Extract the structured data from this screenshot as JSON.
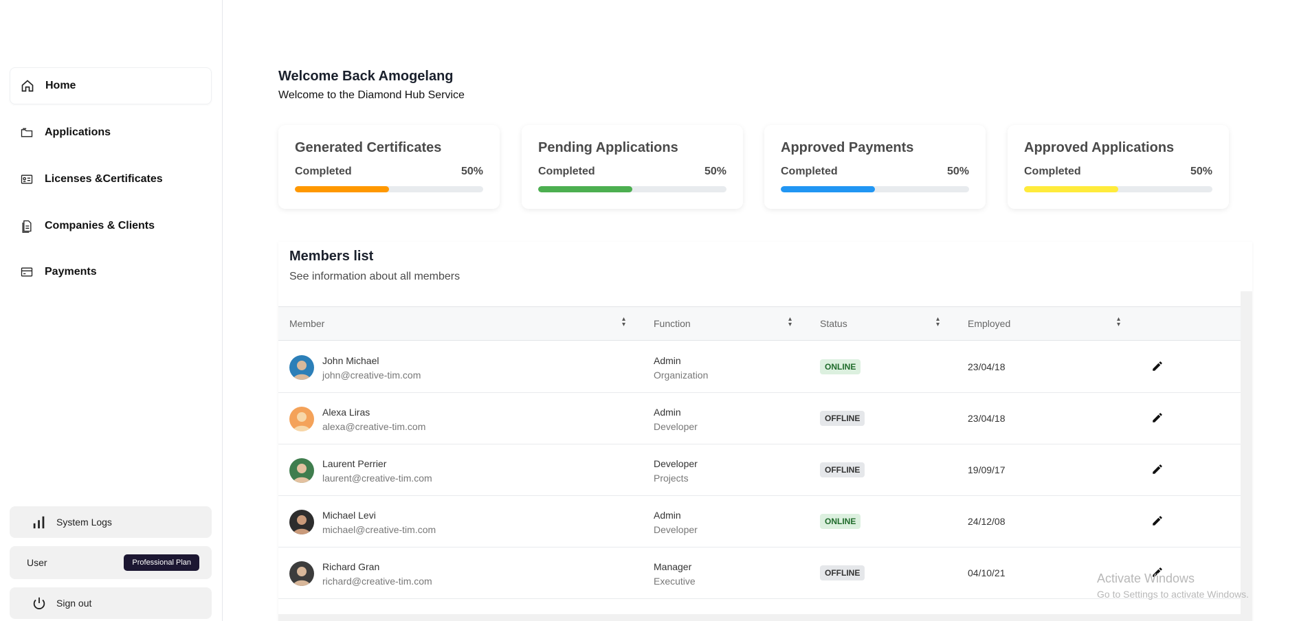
{
  "sidebar": {
    "items": [
      {
        "label": "Home",
        "icon": "home-icon"
      },
      {
        "label": "Applications",
        "icon": "folder-icon"
      },
      {
        "label": "Licenses &Certificates",
        "icon": "id-card-icon"
      },
      {
        "label": "Companies & Clients",
        "icon": "document-icon"
      },
      {
        "label": "Payments",
        "icon": "card-icon"
      }
    ],
    "system_logs": "System Logs",
    "user_label": "User",
    "plan_badge": "Professional Plan",
    "sign_out": "Sign out"
  },
  "welcome": {
    "title": "Welcome Back Amogelang",
    "subtitle": "Welcome to the Diamond Hub Service"
  },
  "cards": [
    {
      "title": "Generated Certificates",
      "status": "Completed",
      "percent_label": "50%",
      "progress": 0.5,
      "color": "#ff9800"
    },
    {
      "title": "Pending Applications",
      "status": "Completed",
      "percent_label": "50%",
      "progress": 0.5,
      "color": "#4caf50"
    },
    {
      "title": "Approved Payments",
      "status": "Completed",
      "percent_label": "50%",
      "progress": 0.5,
      "color": "#2196f3"
    },
    {
      "title": "Approved Applications",
      "status": "Completed",
      "percent_label": "50%",
      "progress": 0.5,
      "color": "#ffeb3b"
    }
  ],
  "members": {
    "title": "Members list",
    "subtitle": "See information about all members",
    "columns": [
      "Member",
      "Function",
      "Status",
      "Employed"
    ],
    "rows": [
      {
        "name": "John Michael",
        "email": "john@creative-tim.com",
        "function": "Admin",
        "department": "Organization",
        "status": "ONLINE",
        "employed": "23/04/18"
      },
      {
        "name": "Alexa Liras",
        "email": "alexa@creative-tim.com",
        "function": "Admin",
        "department": "Developer",
        "status": "OFFLINE",
        "employed": "23/04/18"
      },
      {
        "name": "Laurent Perrier",
        "email": "laurent@creative-tim.com",
        "function": "Developer",
        "department": "Projects",
        "status": "OFFLINE",
        "employed": "19/09/17"
      },
      {
        "name": "Michael Levi",
        "email": "michael@creative-tim.com",
        "function": "Admin",
        "department": "Developer",
        "status": "ONLINE",
        "employed": "24/12/08"
      },
      {
        "name": "Richard Gran",
        "email": "richard@creative-tim.com",
        "function": "Manager",
        "department": "Executive",
        "status": "OFFLINE",
        "employed": "04/10/21"
      }
    ]
  },
  "watermark": {
    "line1": "Activate Windows",
    "line2": "Go to Settings to activate Windows."
  }
}
